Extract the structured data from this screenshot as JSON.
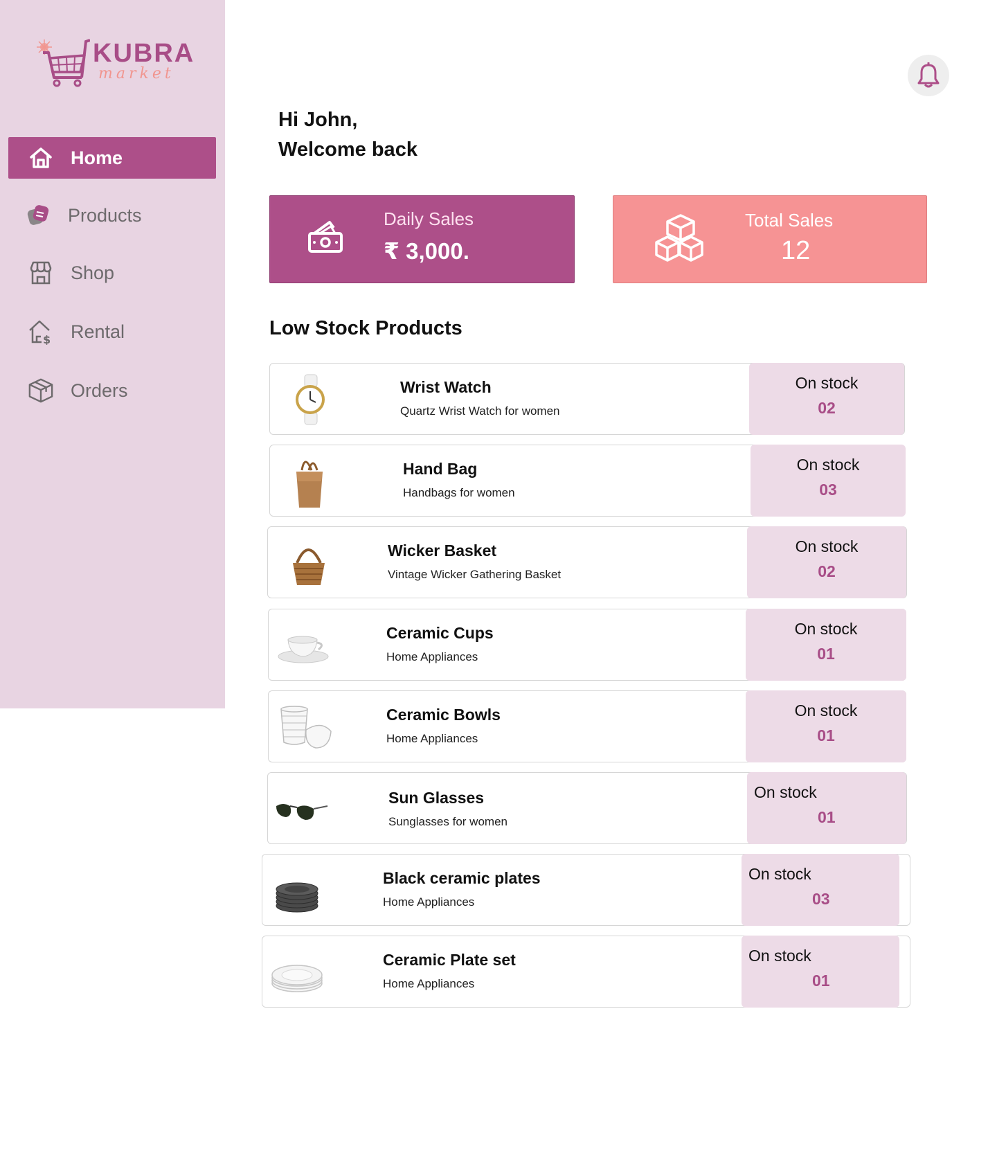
{
  "brand": {
    "name": "KUBRA",
    "sub": "market"
  },
  "nav": {
    "items": [
      {
        "label": "Home",
        "icon": "home-icon",
        "active": true
      },
      {
        "label": "Products",
        "icon": "products-icon"
      },
      {
        "label": "Shop",
        "icon": "shop-icon"
      },
      {
        "label": "Rental",
        "icon": "rental-icon"
      },
      {
        "label": "Orders",
        "icon": "orders-icon"
      }
    ]
  },
  "header": {
    "greeting_line1": "Hi John,",
    "greeting_line2": "Welcome back",
    "notification_icon": "bell-icon"
  },
  "stats": {
    "daily": {
      "label": "Daily Sales",
      "value": "₹ 3,000.",
      "icon": "cash-icon"
    },
    "total": {
      "label": "Total Sales",
      "value": "12",
      "icon": "boxes-icon"
    }
  },
  "low_stock": {
    "title": "Low Stock Products",
    "items": [
      {
        "name": "Wrist Watch",
        "desc": "Quartz Wrist Watch for women",
        "stock_label": "On stock",
        "stock": "02",
        "image": "wrist-watch"
      },
      {
        "name": "Hand Bag",
        "desc": "Handbags for women",
        "stock_label": "On stock",
        "stock": "03",
        "image": "hand-bag"
      },
      {
        "name": "Wicker Basket",
        "desc": "Vintage Wicker Gathering Basket",
        "stock_label": "On stock",
        "stock": "02",
        "image": "wicker-basket"
      },
      {
        "name": "Ceramic Cups",
        "desc": "Home Appliances",
        "stock_label": "On stock",
        "stock": "01",
        "image": "ceramic-cup"
      },
      {
        "name": "Ceramic Bowls",
        "desc": "Home Appliances",
        "stock_label": "On stock",
        "stock": "01",
        "image": "ceramic-bowls"
      },
      {
        "name": "Sun Glasses",
        "desc": "Sunglasses for women",
        "stock_label": "On stock",
        "stock": "01",
        "image": "sunglasses"
      },
      {
        "name": "Black ceramic plates",
        "desc": "Home Appliances",
        "stock_label": "On stock",
        "stock": "03",
        "image": "black-plates"
      },
      {
        "name": "Ceramic Plate set",
        "desc": "Home Appliances",
        "stock_label": "On stock",
        "stock": "01",
        "image": "white-plates"
      }
    ]
  },
  "colors": {
    "primary": "#ad4f89",
    "accent": "#f69394",
    "sidebar": "#e8d4e2",
    "stock_bg": "#eddbe7"
  }
}
